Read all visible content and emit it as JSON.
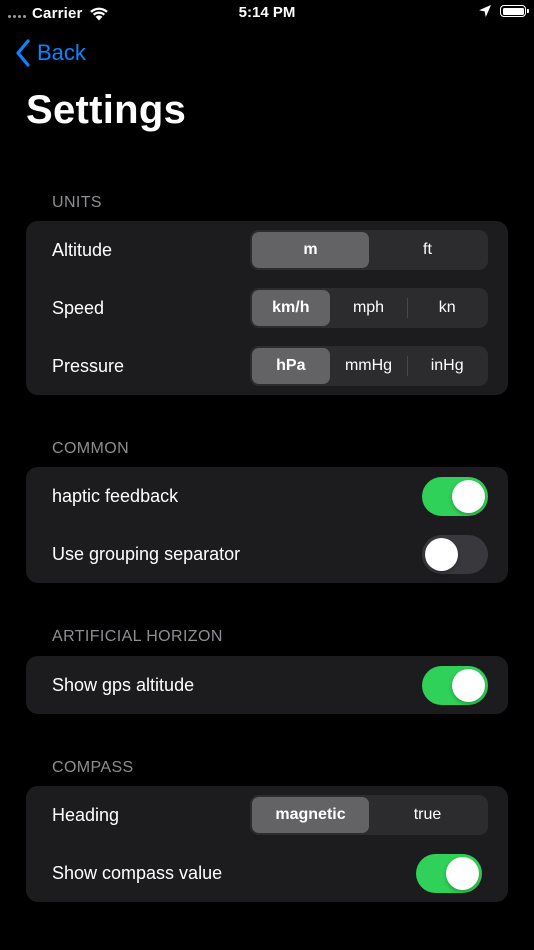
{
  "status_bar": {
    "carrier": "Carrier",
    "time": "5:14 PM",
    "icons": [
      "signal-dots-icon",
      "wifi-icon",
      "location-arrow-icon",
      "battery-icon"
    ]
  },
  "nav": {
    "back_label": "Back",
    "title": "Settings"
  },
  "colors": {
    "accent": "#0a84ff",
    "toggle_on": "#30d158",
    "toggle_off": "#39393d",
    "group_bg": "#1c1c1e",
    "segment_bg": "#2c2c2e",
    "segment_selected": "#636366",
    "header_text": "#8e8e93"
  },
  "sections": {
    "units": {
      "header": "UNITS",
      "altitude": {
        "label": "Altitude",
        "options": [
          "m",
          "ft"
        ],
        "selected": "m"
      },
      "speed": {
        "label": "Speed",
        "options": [
          "km/h",
          "mph",
          "kn"
        ],
        "selected": "km/h"
      },
      "pressure": {
        "label": "Pressure",
        "options": [
          "hPa",
          "mmHg",
          "inHg"
        ],
        "selected": "hPa"
      }
    },
    "common": {
      "header": "COMMON",
      "haptic": {
        "label": "haptic feedback",
        "on": true
      },
      "grouping": {
        "label": "Use grouping separator",
        "on": false
      }
    },
    "horizon": {
      "header": "ARTIFICIAL HORIZON",
      "gps_altitude": {
        "label": "Show gps altitude",
        "on": true
      }
    },
    "compass": {
      "header": "COMPASS",
      "heading": {
        "label": "Heading",
        "options": [
          "magnetic",
          "true"
        ],
        "selected": "magnetic"
      },
      "show_value": {
        "label": "Show compass value",
        "on": true
      }
    }
  }
}
